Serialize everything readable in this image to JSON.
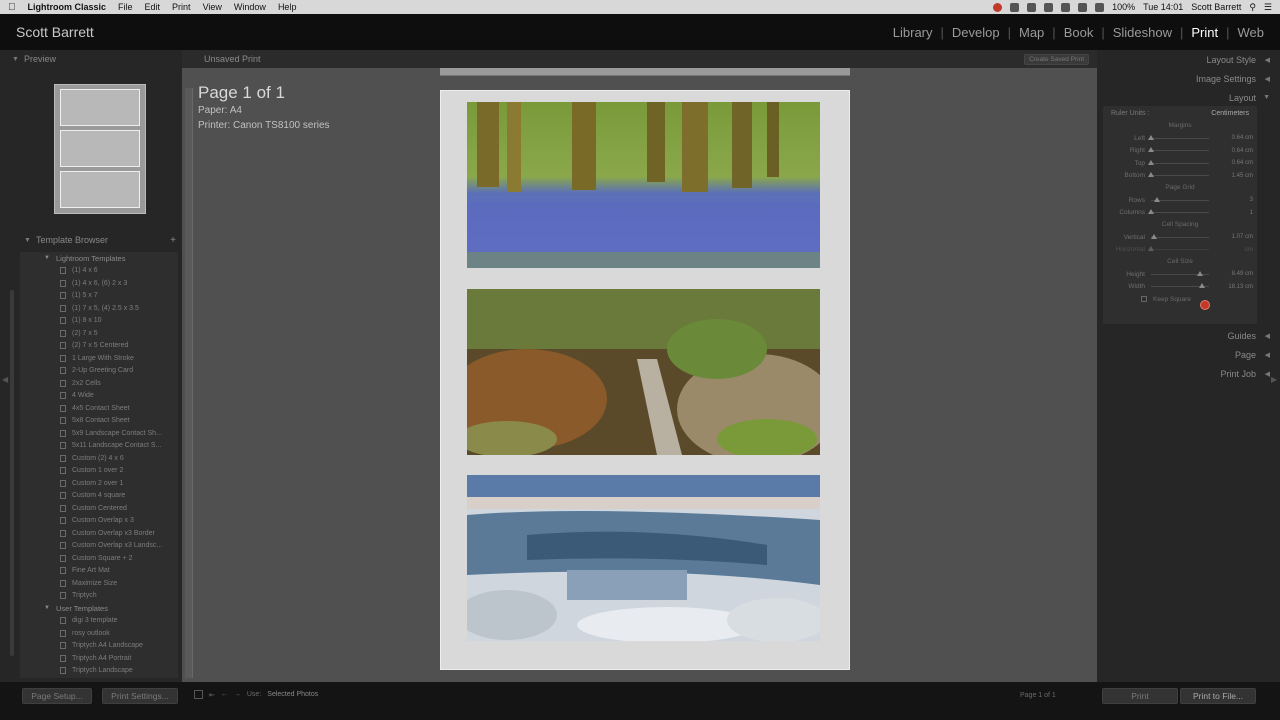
{
  "mac_menu": {
    "app_name": "Lightroom Classic",
    "items": [
      "File",
      "Edit",
      "Print",
      "View",
      "Window",
      "Help"
    ],
    "battery": "100%",
    "clock": "Tue 14:01",
    "user": "Scott Barrett"
  },
  "identity_plate": "Scott Barrett",
  "modules": [
    {
      "label": "Library",
      "active": false
    },
    {
      "label": "Develop",
      "active": false
    },
    {
      "label": "Map",
      "active": false
    },
    {
      "label": "Book",
      "active": false
    },
    {
      "label": "Slideshow",
      "active": false
    },
    {
      "label": "Print",
      "active": true
    },
    {
      "label": "Web",
      "active": false
    }
  ],
  "left_panel": {
    "preview_title": "Preview",
    "template_browser_title": "Template Browser",
    "folders": [
      {
        "label": "Lightroom Templates",
        "items": [
          "(1) 4 x 6",
          "(1) 4 x 6, (6) 2 x 3",
          "(1) 5 x 7",
          "(1) 7 x 5, (4) 2.5 x 3.5",
          "(1) 8 x 10",
          "(2) 7 x 5",
          "(2) 7 x 5 Centered",
          "1 Large With Stroke",
          "2-Up Greeting Card",
          "2x2 Cells",
          "4 Wide",
          "4x5 Contact Sheet",
          "5x8 Contact Sheet",
          "5x9 Landscape Contact Sh...",
          "5x11 Landscape Contact S...",
          "Custom (2) 4 x 6",
          "Custom 1 over 2",
          "Custom 2 over 1",
          "Custom 4 square",
          "Custom Centered",
          "Custom Overlap x 3",
          "Custom Overlap x3 Border",
          "Custom Overlap x3 Landsc...",
          "Custom Square + 2",
          "Fine Art Mat",
          "Maximize Size",
          "Triptych"
        ]
      },
      {
        "label": "User Templates",
        "items": [
          "digi 3 template",
          "rosy outlook",
          "Triptych A4 Landscape",
          "Triptych A4 Portrait",
          "Triptych Landscape"
        ]
      }
    ]
  },
  "workspace": {
    "header_title": "Unsaved Print",
    "create_saved_label": "Create Saved Print",
    "page_title": "Page 1 of 1",
    "paper": "Paper:  A4",
    "printer": "Printer:  Canon TS8100 series"
  },
  "right_panel": {
    "sections_top": [
      "Layout Style",
      "Image Settings",
      "Layout"
    ],
    "ruler_units_label": "Ruler Units :",
    "ruler_units_value": "Centimeters",
    "margins_label": "Margins",
    "margins": [
      {
        "name": "Left",
        "value": "0.64 cm",
        "pos": 0.0
      },
      {
        "name": "Right",
        "value": "0.64 cm",
        "pos": 0.0
      },
      {
        "name": "Top",
        "value": "0.64 cm",
        "pos": 0.0
      },
      {
        "name": "Bottom",
        "value": "1.45 cm",
        "pos": 0.0
      }
    ],
    "page_grid_label": "Page Grid",
    "page_grid": [
      {
        "name": "Rows",
        "value": "3",
        "pos": 0.1
      },
      {
        "name": "Columns",
        "value": "1",
        "pos": 0.0
      }
    ],
    "cell_spacing_label": "Cell Spacing",
    "cell_spacing": [
      {
        "name": "Vertical",
        "value": "1.07 cm",
        "pos": 0.05,
        "disabled": false
      },
      {
        "name": "Horizontal",
        "value": "cm",
        "pos": 0.0,
        "disabled": true
      }
    ],
    "cell_size_label": "Cell Size",
    "cell_size": [
      {
        "name": "Height",
        "value": "8.49 cm",
        "pos": 0.85
      },
      {
        "name": "Width",
        "value": "18.13 cm",
        "pos": 0.88
      }
    ],
    "keep_square_label": "Keep Square",
    "sections_bottom": [
      "Guides",
      "Page",
      "Print Job"
    ]
  },
  "bottom_bar": {
    "page_setup": "Page Setup...",
    "print_settings": "Print Settings...",
    "use_label": "Use:",
    "use_value": "Selected Photos",
    "page_count": "Page 1 of 1",
    "print_btn": "Print",
    "print_to_file_btn": "Print to File..."
  }
}
